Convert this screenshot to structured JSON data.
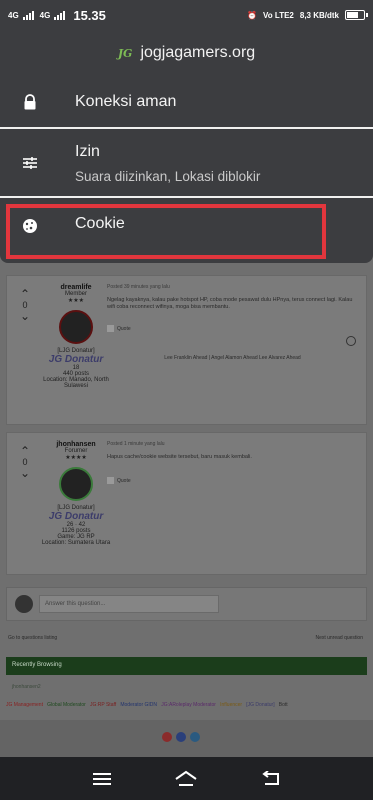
{
  "status_bar": {
    "network_1": "4G",
    "network_2": "4G",
    "time": "15.35",
    "volte": "Vo LTE2",
    "speed": "8,3 KB/dtk"
  },
  "site_info": {
    "domain": "jogjagamers.org",
    "favicon_text": "JG",
    "items": [
      {
        "label": "Koneksi aman",
        "icon": "lock-icon"
      },
      {
        "label": "Izin",
        "sublabel": "Suara diizinkan, Lokasi diblokir",
        "icon": "sliders-icon"
      },
      {
        "label": "Cookie",
        "icon": "cookie-icon"
      }
    ],
    "highlight_color": "#e2363d"
  },
  "posts": [
    {
      "username": "dreamlife",
      "role": "Member",
      "stars": "★★★",
      "group": "[LJG Donatur]",
      "badge": "JG Donatur",
      "points": "18",
      "posts_count": "440 posts",
      "location": "Location: Manado, North Sulawesi",
      "vote": "0",
      "time": "Posted 39 minutes yang lalu",
      "text": "Ngelag kayaknya, kalau pake hotspot HP, coba mode pesawat dulu HPnya, terus connect lagi. Kalau wifi coba reconnect wifinya, moga bisa membantu.",
      "quote_label": "Quote",
      "signature_line": "Lee Franklin Ahead | Angel Alamon Ahead Lee Alvarez Ahead"
    },
    {
      "username": "jhonhansen",
      "role": "Forumer",
      "stars": "★★★★",
      "group": "[LJG Donatur]",
      "badge": "JG Donatur",
      "points_1": "26",
      "points_2": "42",
      "posts_count": "1126 posts",
      "game": "Game: JG RP",
      "location": "Location: Sumatera Utara",
      "vote": "0",
      "time": "Posted 1 minute yang lalu",
      "text": "Hapus cache/cookie website tersebut, baru masuk kembali.",
      "quote_label": "Quote"
    }
  ],
  "answer_placeholder": "Answer this question...",
  "nav_prev": "Go to questions listing",
  "nav_next": "Next unread question",
  "recently_browsing": "Recently Browsing",
  "recently_user": "jhonhansen2",
  "roles": [
    "JG Management",
    "Global Moderator",
    "JG:RP Staff",
    "Moderator GIDN",
    "JG:ARoleplay Moderator",
    "Influencer",
    "[JG Donatur]",
    "Bott"
  ]
}
